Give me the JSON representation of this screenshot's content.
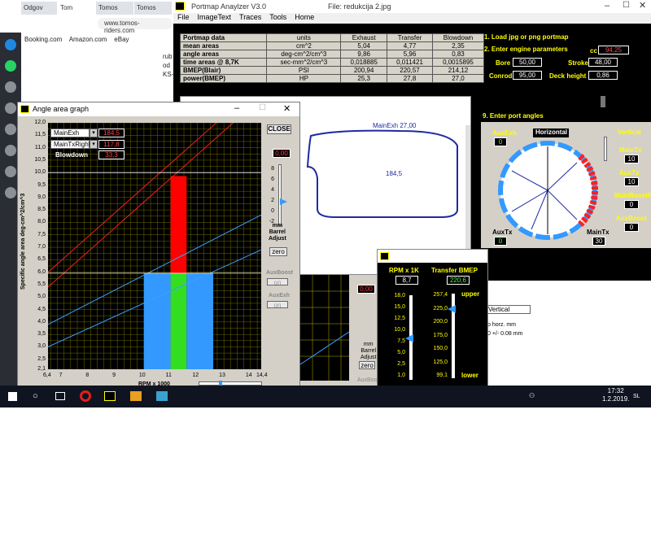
{
  "browser": {
    "tabs": [
      "Odgov",
      "Tom",
      "Tomos",
      "Tomos"
    ],
    "url": "www.tomos-riders.com",
    "bookmarks": [
      "Booking.com",
      "Amazon.com",
      "eBay"
    ],
    "side_text": [
      "rub",
      "od",
      "KS-"
    ]
  },
  "portmap": {
    "title": "Portmap Anaylzer V3.0",
    "file": "File: redukcija 2.jpg",
    "menu": [
      "File",
      "ImageText",
      "Traces",
      "Tools",
      "Home"
    ],
    "table": {
      "header": [
        "Portmap data",
        "units",
        "Exhaust",
        "Transfer",
        "Blowdown"
      ],
      "rows": [
        [
          "mean areas",
          "cm^2",
          "5,04",
          "4,77",
          "2,35"
        ],
        [
          "angle areas",
          "deg-cm^2/cm^3",
          "9,86",
          "5,96",
          "0,83"
        ],
        [
          "time areas @ 8,7K",
          "sec-mm^2/cm^3",
          "0,018885",
          "0,011421",
          "0,0015895"
        ],
        [
          "BMEP(Blair)",
          "PSI",
          "200,94",
          "220,57",
          "214,12"
        ],
        [
          "power(BMEP)",
          "HP",
          "25,3",
          "27,8",
          "27,0"
        ]
      ]
    },
    "step1": "1. Load jpg or png portmap",
    "step2": "2. Enter engine parameters",
    "params": {
      "cc_label": "cc",
      "cc": "94,25",
      "bore_label": "Bore",
      "bore": "50,00",
      "stroke_label": "Stroke",
      "stroke": "48,00",
      "conrod_label": "Conrod",
      "conrod": "95,00",
      "deck_label": "Deck height",
      "deck": "0,86"
    },
    "step9": "9. Enter port angles",
    "aux_exh_label": "AuxExh",
    "aux_exh": "0",
    "horizontal": "Horizontal",
    "vertical": "Vertical",
    "main_tx_label": "MainTx",
    "main_tx": "10",
    "aux_tx_label": "AuxTx",
    "aux_tx": "10",
    "main_boost_label": "MainBoostP",
    "main_boost": "0",
    "aux_boost_label": "AuxBoost",
    "aux_boost": "0",
    "auxtx_bottom_label": "AuxTx",
    "auxtx_bottom": "0",
    "maintx_bottom_label": "MainTx",
    "maintx_bottom": "30",
    "port_label": "MainExh 27,00",
    "port_area": "184,5"
  },
  "angle": {
    "title": "Angle area graph",
    "close": "CLOSE",
    "main_exh_label": "MainExh",
    "main_exh": "184,5",
    "main_tx_label": "MainTxRight",
    "main_tx": "117,8",
    "blowdown_label": "Blowdown",
    "blowdown": "33,3",
    "adjust_value": "0,00",
    "adjust_ticks": [
      "8",
      "6",
      "4",
      "2",
      "0",
      "-2"
    ],
    "mm": "mm",
    "barrel": "Barrel",
    "adjust": "Adjust",
    "zero": "zero",
    "aux_boost": "AuxBoost",
    "aux_exh": "AuxExh",
    "on": "on",
    "ylabel": "Specific angle area  deg-cm^2/cm^3",
    "xlabel": "RPM x 1000"
  },
  "chart_data": {
    "type": "bar",
    "ylim": [
      2.1,
      12.0
    ],
    "xlim": [
      6.4,
      14.4
    ],
    "yticks": [
      "12,0",
      "11,5",
      "11,0",
      "10,5",
      "10,0",
      "9,5",
      "9,0",
      "8,5",
      "8,0",
      "7,5",
      "7,0",
      "6,5",
      "6,0",
      "5,5",
      "5,0",
      "4,5",
      "4,0",
      "3,5",
      "3,0",
      "2,5",
      "2,1"
    ],
    "xticks": [
      "6,4",
      "7",
      "8",
      "9",
      "10",
      "11",
      "12",
      "13",
      "14",
      "14,4"
    ],
    "bars": [
      {
        "x0": 10,
        "x1": 11,
        "y0": 2.1,
        "y1": 5.96,
        "color": "#3399ff"
      },
      {
        "x0": 11,
        "x1": 11.6,
        "y0": 2.1,
        "y1": 5.96,
        "color": "#33dd22"
      },
      {
        "x0": 11.6,
        "x1": 12.6,
        "y0": 2.1,
        "y1": 5.96,
        "color": "#3399ff"
      },
      {
        "x0": 11,
        "x1": 11.6,
        "y0": 5.96,
        "y1": 9.86,
        "color": "#ff0000"
      }
    ],
    "lines": [
      {
        "color": "#ff2020",
        "pts": [
          [
            6.4,
            5.4
          ],
          [
            14.4,
            13.0
          ]
        ]
      },
      {
        "color": "#ff2020",
        "pts": [
          [
            6.4,
            6.0
          ],
          [
            14.4,
            13.6
          ]
        ]
      },
      {
        "color": "#3aa0ff",
        "pts": [
          [
            6.4,
            3.9
          ],
          [
            14.4,
            8.3
          ]
        ]
      },
      {
        "color": "#3aa0ff",
        "pts": [
          [
            6.4,
            3.0
          ],
          [
            14.4,
            6.9
          ]
        ]
      }
    ]
  },
  "rpm": {
    "rpm_label": "RPM x 1K",
    "rpm": "8,7",
    "bmep_label": "Transfer BMEP",
    "bmep": "220,6",
    "rpm_ticks": [
      "18,0",
      "15,0",
      "12,5",
      "10,0",
      "7,5",
      "5,0",
      "2,5",
      "1,0"
    ],
    "bmep_ticks": [
      "257,4",
      "225,0",
      "200,0",
      "175,0",
      "150,0",
      "125,0",
      "99,1"
    ],
    "upper": "upper",
    "lower": "lower"
  },
  "bg2": {
    "value": "0,00",
    "mm": "mm",
    "barrel": "Barrel",
    "adjust": "Adjust",
    "zero": "zero",
    "aux": "AuxBoost",
    "vertical": "Vertical",
    "horz": "p horz. mm",
    "tol": "0 +/- 0.08 mm"
  },
  "taskbar": {
    "time": "17:32",
    "date": "1.2.2019.",
    "lang": "SL"
  }
}
